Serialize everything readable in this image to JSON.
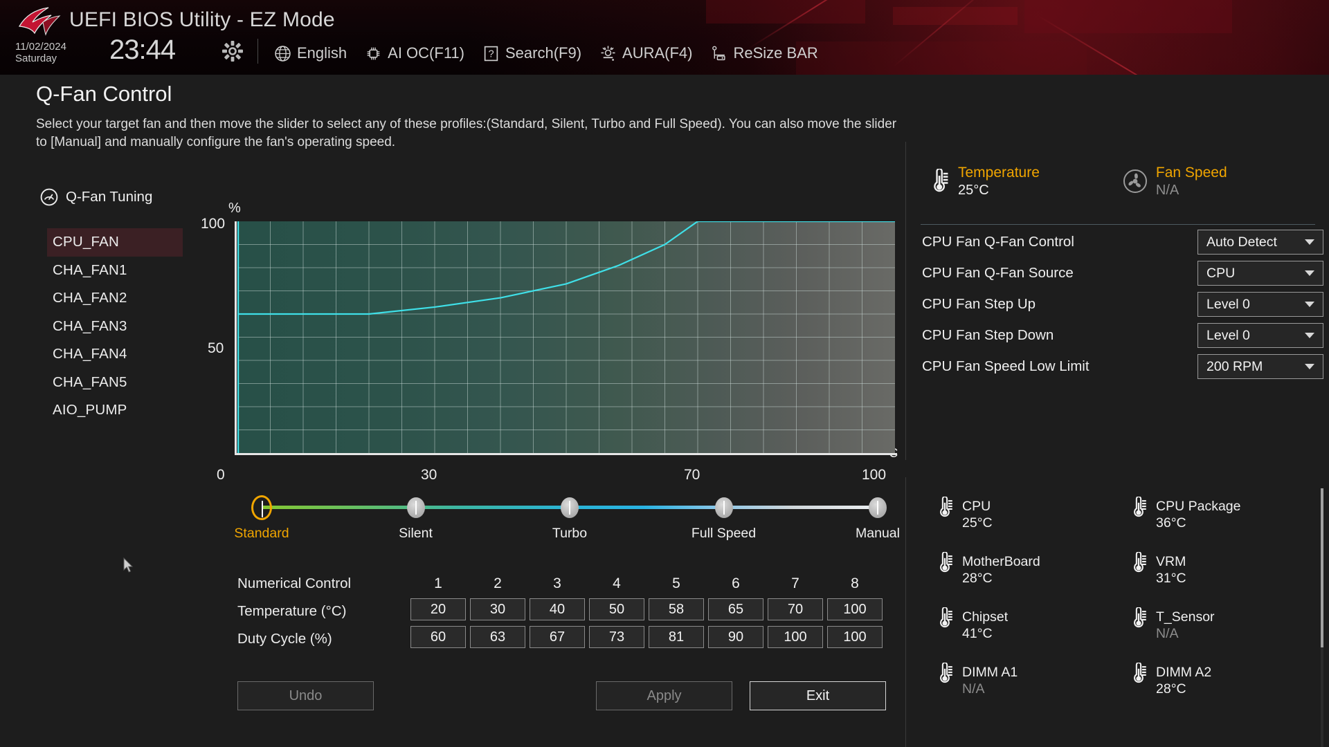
{
  "header": {
    "app_title": "UEFI BIOS Utility - EZ Mode",
    "date": "11/02/2024",
    "day": "Saturday",
    "time": "23:44",
    "gear_icon": "gear-icon",
    "menu": [
      {
        "label": "English",
        "icon": "globe-icon"
      },
      {
        "label": "AI OC(F11)",
        "icon": "ai-oc-icon"
      },
      {
        "label": "Search(F9)",
        "icon": "question-box-icon"
      },
      {
        "label": "AURA(F4)",
        "icon": "aura-light-icon"
      },
      {
        "label": "ReSize BAR",
        "icon": "resize-bar-icon"
      }
    ]
  },
  "page": {
    "title": "Q-Fan Control",
    "description": "Select your target fan and then move the slider to select any of these profiles:(Standard, Silent, Turbo and Full Speed). You can also move the slider to [Manual] and manually configure the fan's operating speed."
  },
  "sidebar": {
    "tuning_label": "Q-Fan Tuning",
    "tuning_icon": "speedometer-icon",
    "fans": [
      {
        "label": "CPU_FAN",
        "selected": true
      },
      {
        "label": "CHA_FAN1",
        "selected": false
      },
      {
        "label": "CHA_FAN2",
        "selected": false
      },
      {
        "label": "CHA_FAN3",
        "selected": false
      },
      {
        "label": "CHA_FAN4",
        "selected": false
      },
      {
        "label": "CHA_FAN5",
        "selected": false
      },
      {
        "label": "AIO_PUMP",
        "selected": false
      }
    ]
  },
  "chart_data": {
    "type": "line",
    "title": "",
    "xlabel": "°C",
    "ylabel": "%",
    "xlim": [
      0,
      100
    ],
    "ylim": [
      0,
      100
    ],
    "xticks": [
      0,
      30,
      70,
      100
    ],
    "xtick_labels": [
      "0",
      "30",
      "70",
      "100"
    ],
    "yticks": [
      50,
      100
    ],
    "ytick_labels": [
      "50",
      "100"
    ],
    "grid": true,
    "line_color": "#3fe0e8",
    "series": [
      {
        "name": "CPU_FAN fan curve",
        "x": [
          0,
          20,
          30,
          40,
          50,
          58,
          65,
          70,
          100
        ],
        "y": [
          60,
          60,
          63,
          67,
          73,
          81,
          90,
          100,
          100
        ]
      }
    ]
  },
  "chart_labels": {
    "pct": "%",
    "y100": "100",
    "y50": "50",
    "degc": "°C",
    "x0": "0",
    "x30": "30",
    "x70": "70",
    "x100": "100"
  },
  "slider": {
    "profiles": [
      {
        "label": "Standard",
        "active": true
      },
      {
        "label": "Silent",
        "active": false
      },
      {
        "label": "Turbo",
        "active": false
      },
      {
        "label": "Full Speed",
        "active": false
      },
      {
        "label": "Manual",
        "active": false
      }
    ]
  },
  "numerical_control": {
    "row_label": "Numerical Control",
    "temp_label": "Temperature (°C)",
    "duty_label": "Duty Cycle (%)",
    "columns": [
      "1",
      "2",
      "3",
      "4",
      "5",
      "6",
      "7",
      "8"
    ],
    "temperature": [
      "20",
      "30",
      "40",
      "50",
      "58",
      "65",
      "70",
      "100"
    ],
    "duty_cycle": [
      "60",
      "63",
      "67",
      "73",
      "81",
      "90",
      "100",
      "100"
    ]
  },
  "buttons": {
    "undo": "Undo",
    "apply": "Apply",
    "exit": "Exit"
  },
  "right_panel": {
    "stats": [
      {
        "name": "Temperature",
        "value": "25°C",
        "icon": "thermometer-icon",
        "na": false
      },
      {
        "name": "Fan Speed",
        "value": "N/A",
        "icon": "fan-icon",
        "na": true
      }
    ],
    "settings": [
      {
        "label": "CPU Fan Q-Fan Control",
        "value": "Auto Detect"
      },
      {
        "label": "CPU Fan Q-Fan Source",
        "value": "CPU"
      },
      {
        "label": "CPU Fan Step Up",
        "value": "Level 0"
      },
      {
        "label": "CPU Fan Step Down",
        "value": "Level 0"
      },
      {
        "label": "CPU Fan Speed Low Limit",
        "value": "200 RPM"
      }
    ]
  },
  "hardware_monitor": {
    "items": [
      {
        "name": "CPU",
        "value": "25°C",
        "na": false
      },
      {
        "name": "CPU Package",
        "value": "36°C",
        "na": false
      },
      {
        "name": "MotherBoard",
        "value": "28°C",
        "na": false
      },
      {
        "name": "VRM",
        "value": "31°C",
        "na": false
      },
      {
        "name": "Chipset",
        "value": "41°C",
        "na": false
      },
      {
        "name": "T_Sensor",
        "value": "N/A",
        "na": true
      },
      {
        "name": "DIMM A1",
        "value": "N/A",
        "na": true
      },
      {
        "name": "DIMM A2",
        "value": "28°C",
        "na": false
      }
    ]
  },
  "colors": {
    "accent_gold": "#f0a500",
    "curve_cyan": "#3fe0e8",
    "selection_red": "#3b2024"
  }
}
